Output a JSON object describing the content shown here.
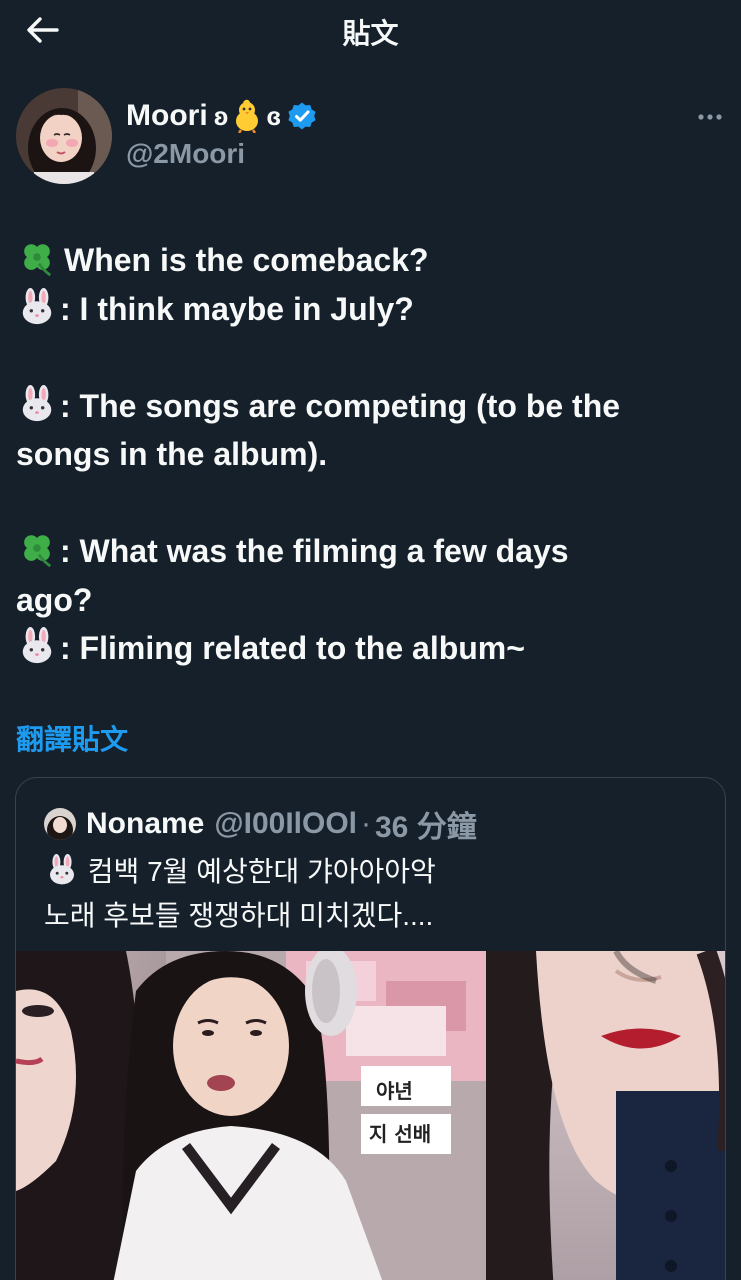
{
  "header": {
    "title": "貼文"
  },
  "author": {
    "name": "Moori",
    "name_left": "ʚ",
    "name_right": "ɞ",
    "handle": "@2Moori"
  },
  "tweet": {
    "l1": "When is the comeback?",
    "l2": ": I think maybe in July?",
    "l3": ": The songs are competing (to be the",
    "l4": "songs in the album).",
    "l5": ": What was the filming a few days",
    "l6": "ago?",
    "l7": ": Fliming related to the album~"
  },
  "translate_label": "翻譯貼文",
  "quote": {
    "name": "Noname",
    "handle": "@I00IlOOl",
    "separator": "·",
    "time": "36 分鐘",
    "line1": " 컴백 7월 예상한대 갸아아아악",
    "line2": "노래 후보들 쟁쟁하대 미치겠다...."
  },
  "media_text": {
    "sign1": "야년",
    "sign2": "지 선배"
  },
  "icons": {
    "back": "arrow-left-icon",
    "verified": "verified-badge-icon",
    "more": "more-dots-icon",
    "clover": "four-leaf-clover-emoji",
    "rabbit": "rabbit-face-emoji",
    "chick": "baby-chick-emoji"
  },
  "colors": {
    "background": "#15202b",
    "accent": "#1d9bf0",
    "secondary_text": "#8b98a5",
    "border": "#38444d"
  }
}
